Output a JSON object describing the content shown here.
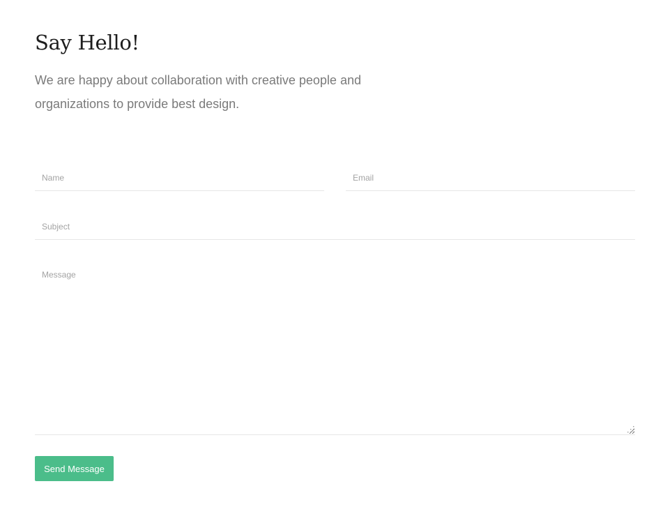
{
  "contact": {
    "title": "Say Hello!",
    "intro": "We are happy about collaboration with creative people and organizations to provide best design."
  },
  "form": {
    "name_placeholder": "Name",
    "email_placeholder": "Email",
    "subject_placeholder": "Subject",
    "message_placeholder": "Message",
    "name_value": "",
    "email_value": "",
    "subject_value": "",
    "message_value": "",
    "send_label": "Send Message"
  },
  "colors": {
    "accent": "#4bbd8a",
    "heading": "#1d1d1d",
    "body_text": "#7a7a7a",
    "field_border": "#e6e6e6",
    "placeholder": "#a3a3a3"
  },
  "icons": {
    "resize_handle": "textarea-resize-grip-icon"
  }
}
